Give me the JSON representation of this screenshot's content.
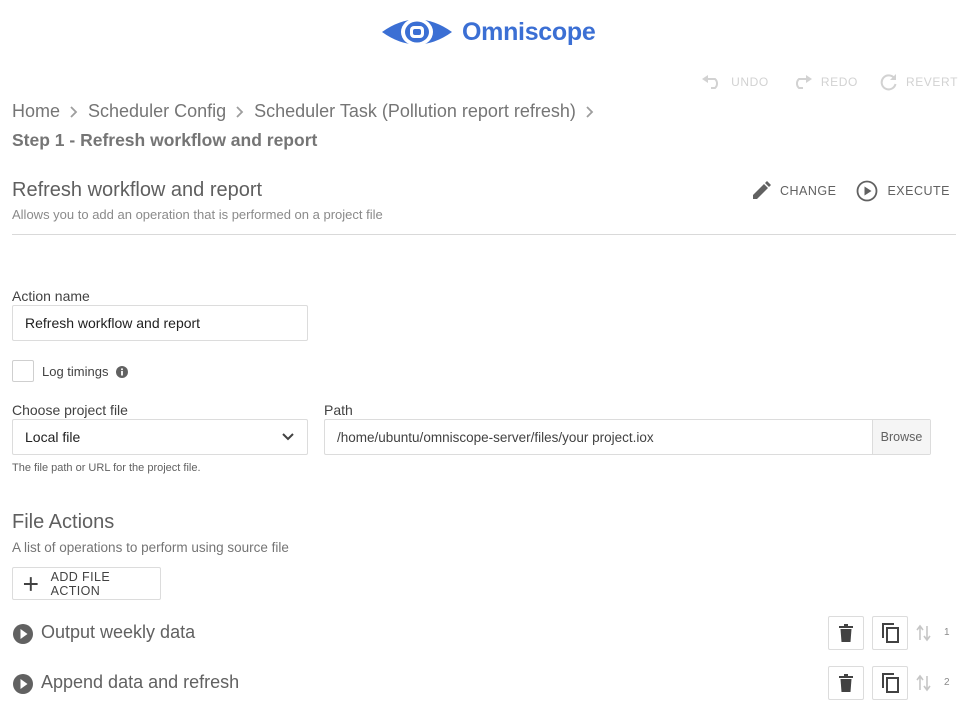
{
  "brand": {
    "name": "Omniscope",
    "color": "#3b6fd4",
    "icon": "eye-logo-icon"
  },
  "history": {
    "undo": {
      "label": "UNDO",
      "icon": "undo-icon"
    },
    "redo": {
      "label": "REDO",
      "icon": "redo-icon"
    },
    "revert": {
      "label": "REVERT",
      "icon": "revert-icon"
    }
  },
  "breadcrumb": {
    "items": [
      "Home",
      "Scheduler Config",
      "Scheduler Task (Pollution report refresh)"
    ],
    "separator_icon": "chevron-right-icon"
  },
  "step_title": "Step 1 - Refresh workflow and report",
  "section": {
    "title": "Refresh workflow and report",
    "subtitle": "Allows you to add an operation that is performed on a project file",
    "change": {
      "label": "CHANGE",
      "icon": "pencil-icon"
    },
    "execute": {
      "label": "EXECUTE",
      "icon": "play-circle-icon"
    }
  },
  "form": {
    "action_name": {
      "label": "Action name",
      "value": "Refresh workflow and report"
    },
    "log_timings": {
      "label": "Log timings",
      "checked": false,
      "icon": "info-icon"
    },
    "project_file": {
      "label": "Choose project file",
      "value": "Local file",
      "icon": "chevron-down-icon"
    },
    "path": {
      "label": "Path",
      "value": "/home/ubuntu/omniscope-server/files/your project.iox",
      "browse_label": "Browse"
    },
    "helper": "The file path or URL for the project file."
  },
  "file_actions": {
    "title": "File Actions",
    "subtitle": "A list of operations to perform using source file",
    "add_label": "ADD FILE ACTION",
    "items": [
      {
        "label": "Output weekly data",
        "index": "1"
      },
      {
        "label": "Append data and refresh",
        "index": "2"
      }
    ]
  },
  "colors": {
    "accent": "#3b6fd4",
    "muted_text": "#757575",
    "border": "#dcdcdc",
    "disabled": "#d2d2d2"
  }
}
